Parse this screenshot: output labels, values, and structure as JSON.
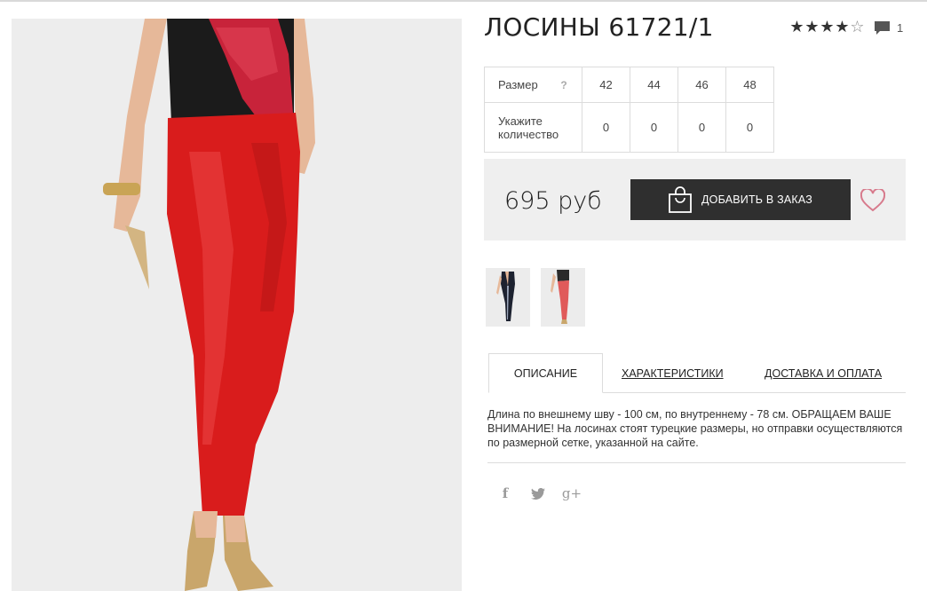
{
  "product": {
    "title": "ЛОСИНЫ 61721/1",
    "rating_stars": 4,
    "rating_max": 5,
    "comment_count": "1",
    "photo_colors": {
      "background": "#ededed",
      "pants": "#d91c1c",
      "top": "#1b1b1b",
      "scarf": "#c8233a",
      "skin": "#e6b899",
      "shoe": "#c9a66b"
    }
  },
  "size_table": {
    "size_label": "Размер",
    "help_mark": "?",
    "sizes": [
      "42",
      "44",
      "46",
      "48"
    ],
    "qty_label_line1": "Укажите",
    "qty_label_line2": "количество",
    "quantities": [
      "0",
      "0",
      "0",
      "0"
    ]
  },
  "purchase": {
    "price": "695 руб",
    "add_button_label": "ДОБАВИТЬ В ЗАКАЗ"
  },
  "tabs": [
    {
      "label": "ОПИСАНИЕ",
      "active": true
    },
    {
      "label": "ХАРАКТЕРИСТИКИ",
      "active": false
    },
    {
      "label": "ДОСТАВКА И ОПЛАТА",
      "active": false
    }
  ],
  "description": "Длина по внешнему шву - 100 см, по внутреннему - 78 см. ОБРАЩАЕМ ВАШЕ ВНИМАНИЕ! На лосинах стоят турецкие размеры, но отправки осуществляются по размерной сетке, указанной на сайте.",
  "social": {
    "facebook_glyph": "f",
    "twitter_glyph": "🐦",
    "gplus_glyph": "g+"
  },
  "colors": {
    "button_bg": "#2f2f2f",
    "price_box_bg": "#efefef",
    "heart": "#d77a8c"
  }
}
